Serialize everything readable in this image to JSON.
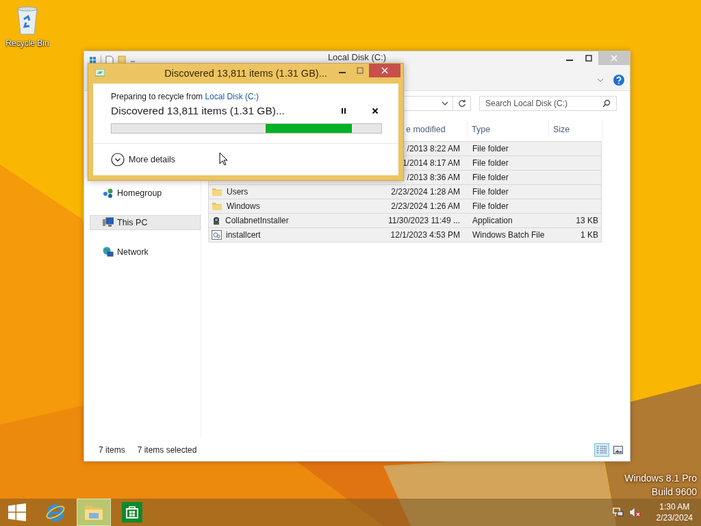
{
  "desktop": {
    "icons": [
      {
        "label": "Recycle Bin",
        "kind": "recycle-bin"
      }
    ],
    "watermark": [
      "Windows 8.1 Pro",
      "Build 9600"
    ]
  },
  "explorer": {
    "title": "Local Disk (C:)",
    "search": {
      "placeholder": "Search Local Disk (C:)"
    },
    "columns": [
      {
        "label": "e modified"
      },
      {
        "label": "Type"
      },
      {
        "label": "Size"
      }
    ],
    "rows": [
      {
        "date": "/2013 8:22 AM",
        "type": "File folder",
        "selected": true
      },
      {
        "date": "1/2014 8:17 AM",
        "type": "File folder",
        "selected": true
      },
      {
        "date": "/2013 8:36 AM",
        "type": "File folder",
        "selected": true
      },
      {
        "name": "Users",
        "date": "2/23/2024 1:28 AM",
        "type": "File folder",
        "kind": "folder",
        "selected": true
      },
      {
        "name": "Windows",
        "date": "2/23/2024 1:26 AM",
        "type": "File folder",
        "kind": "folder",
        "selected": true
      },
      {
        "name": "CollabnetInstaller",
        "date": "11/30/2023 11:49 ...",
        "type": "Application",
        "size": "13 KB",
        "kind": "app",
        "selected": true
      },
      {
        "name": "installcert",
        "date": "12/1/2023 4:53 PM",
        "type": "Windows Batch File",
        "size": "1 KB",
        "kind": "batch",
        "selected": true
      }
    ],
    "nav": [
      {
        "label": "Homegroup",
        "kind": "homegroup",
        "selected": false
      },
      {
        "label": "This PC",
        "kind": "pc",
        "selected": true
      },
      {
        "label": "Network",
        "kind": "network",
        "selected": false
      }
    ],
    "status": {
      "count": "7 items",
      "selection": "7 items selected"
    },
    "views": [
      {
        "kind": "details",
        "selected": true
      },
      {
        "kind": "large-icons",
        "selected": false
      }
    ]
  },
  "dialog": {
    "title": "Discovered 13,811 items (1.31 GB)...",
    "source_prefix": "Preparing to recycle from",
    "source_link": "Local Disk (C:)",
    "status": "Discovered 13,811 items (1.31 GB)...",
    "indeterminate": true,
    "more_details": "More details"
  },
  "taskbar": {
    "apps": [
      {
        "kind": "ie",
        "active": false
      },
      {
        "kind": "explorer",
        "active": true
      },
      {
        "kind": "store",
        "active": false
      }
    ],
    "muted": true,
    "time": "1:30 AM",
    "date": "2/23/2024"
  }
}
